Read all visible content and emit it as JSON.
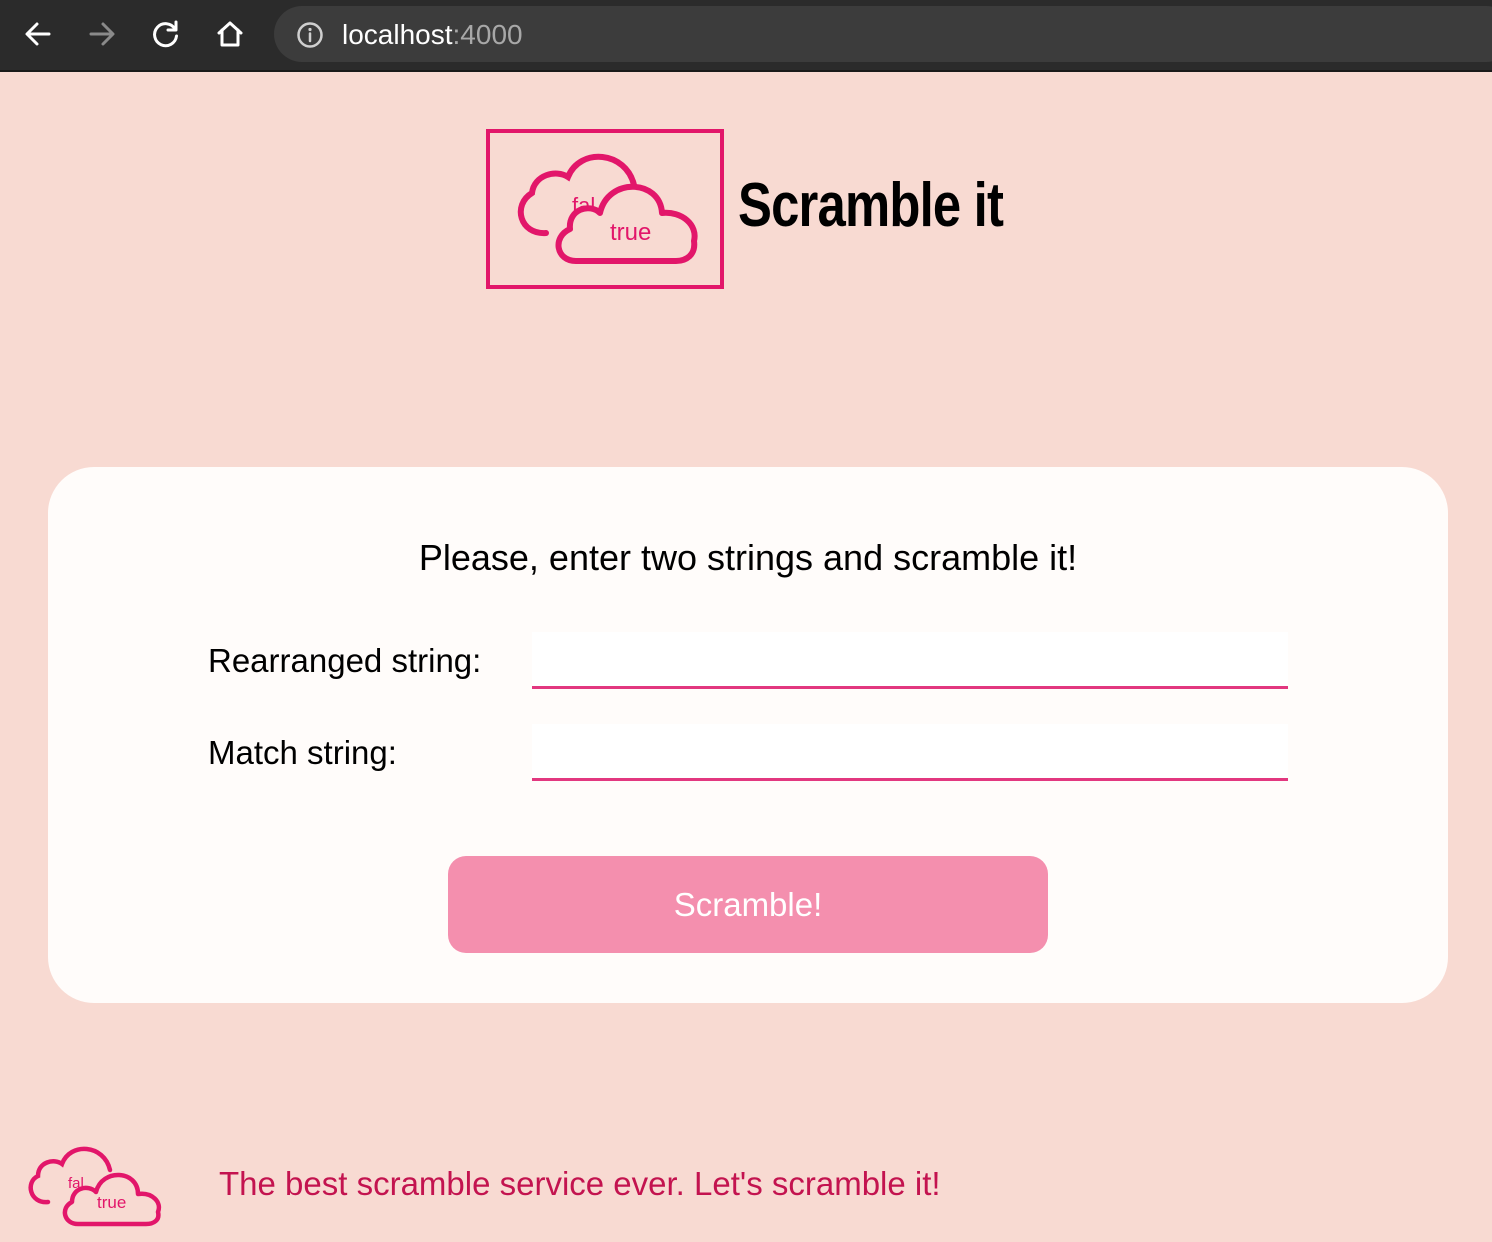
{
  "browser": {
    "url_host": "localhost",
    "url_port": ":4000"
  },
  "header": {
    "logo_word_a": "fal",
    "logo_word_b": "true",
    "title": "Scramble it"
  },
  "form": {
    "prompt": "Please, enter two strings and scramble it!",
    "rearranged_label": "Rearranged string:",
    "rearranged_value": "",
    "match_label": "Match string:",
    "match_value": "",
    "submit_label": "Scramble!"
  },
  "footer": {
    "logo_word_a": "fal",
    "logo_word_b": "true",
    "tagline": "The best scramble service ever. Let's scramble it!"
  },
  "colors": {
    "accent": "#e2166a",
    "background": "#f8dad2",
    "button": "#f48fae"
  }
}
